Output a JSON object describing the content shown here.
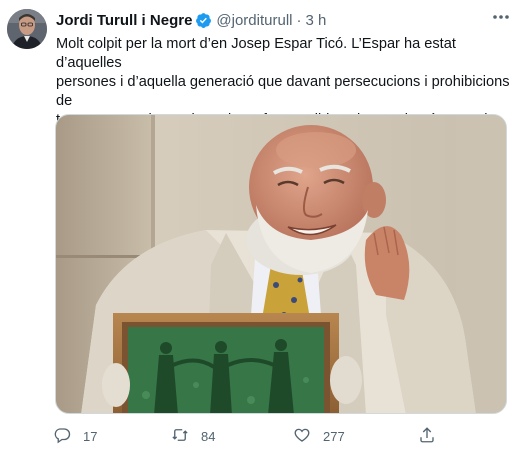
{
  "author": {
    "display_name": "Jordi Turull i Negre",
    "handle": "@jorditurull",
    "separator": "·",
    "time": "3 h"
  },
  "tweet": {
    "text": "Molt colpit per la mort d’en Josep Espar Ticó.  L’Espar ha estat d’aquelles\npersones i d’aquella generació que davant persecucions i prohibicions de\ntota mena, se la van jugar i  van fer possible salvar molt més que els mots.\nUn patriota de cap a peus. Un gran referent. DEP"
  },
  "actions": {
    "replies": "17",
    "retweets": "84",
    "likes": "277"
  },
  "icons": {
    "verified": "verified-badge-icon",
    "more": "more-dots-icon",
    "reply": "reply-icon",
    "retweet": "retweet-icon",
    "like": "heart-icon",
    "share": "share-icon"
  },
  "colors": {
    "text": "#0f1419",
    "secondary": "#536471",
    "verified": "#1d9bf0"
  }
}
